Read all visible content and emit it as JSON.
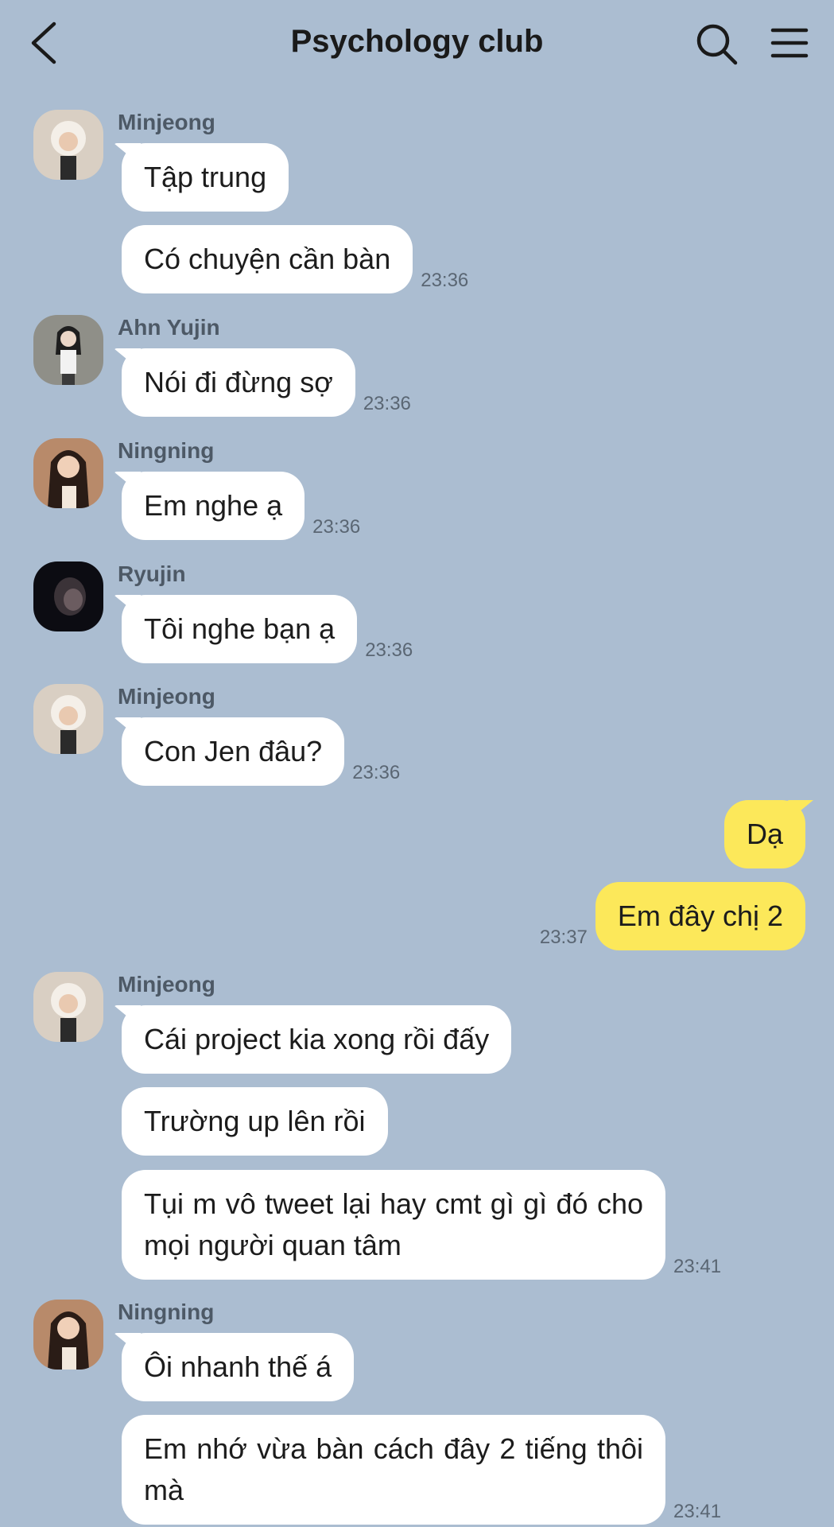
{
  "header": {
    "title": "Psychology club",
    "back_icon": "chevron-left-icon",
    "search_icon": "search-icon",
    "menu_icon": "hamburger-menu-icon"
  },
  "colors": {
    "background": "#abbdd1",
    "incoming_bubble": "#ffffff",
    "outgoing_bubble": "#fce85a"
  },
  "messages": [
    {
      "sender": "Minjeong",
      "bubbles": [
        "Tập trung",
        "Có chuyện cần bàn"
      ],
      "time": "23:36"
    },
    {
      "sender": "Ahn Yujin",
      "bubbles": [
        "Nói đi đừng sợ"
      ],
      "time": "23:36"
    },
    {
      "sender": "Ningning",
      "bubbles": [
        "Em nghe ạ"
      ],
      "time": "23:36"
    },
    {
      "sender": "Ryujin",
      "bubbles": [
        "Tôi nghe bạn ạ"
      ],
      "time": "23:36"
    },
    {
      "sender": "Minjeong",
      "bubbles": [
        "Con Jen đâu?"
      ],
      "time": "23:36"
    },
    {
      "sender": "me",
      "bubbles": [
        "Dạ",
        "Em đây chị 2"
      ],
      "time": "23:37"
    },
    {
      "sender": "Minjeong",
      "bubbles": [
        "Cái project kia xong rồi đấy",
        "Trường up lên rồi",
        "Tụi m vô tweet lại hay cmt gì gì đó cho mọi người quan tâm"
      ],
      "time": "23:41"
    },
    {
      "sender": "Ningning",
      "bubbles": [
        "Ôi nhanh thế á",
        "Em nhớ vừa bàn cách đây 2 tiếng thôi mà"
      ],
      "time": "23:41"
    }
  ]
}
